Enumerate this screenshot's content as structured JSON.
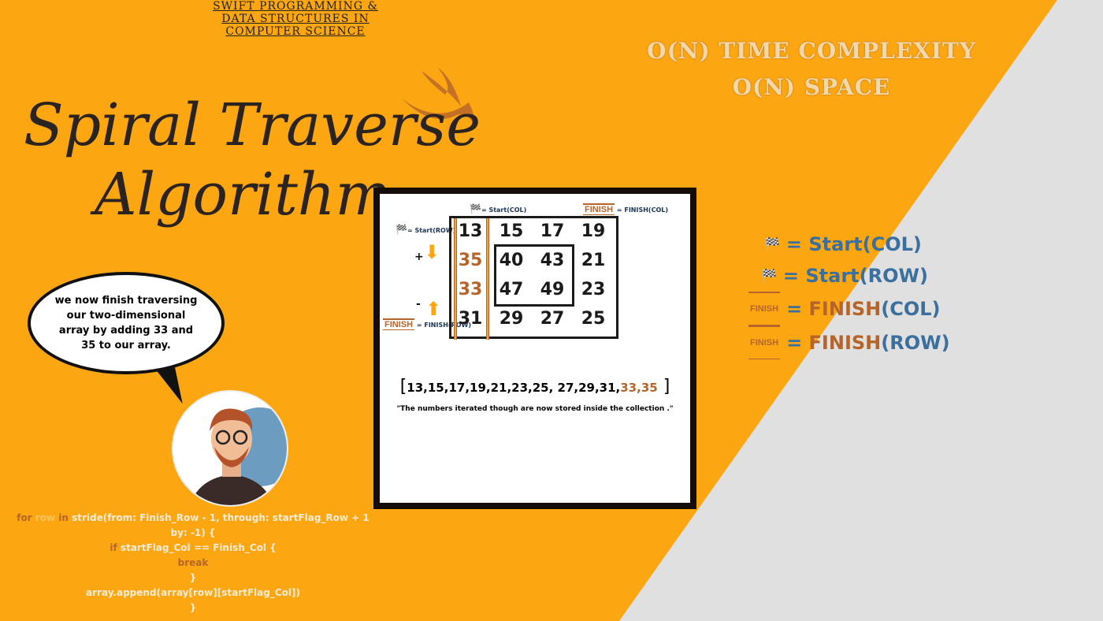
{
  "header": [
    "SWIFT PROGRAMMING &",
    "DATA STRUCTURES IN",
    "COMPUTER SCIENCE"
  ],
  "title": [
    "Spiral Traverse",
    "Algorithm"
  ],
  "complexity": [
    "O(N) TIME COMPLEXITY",
    "O(N) SPACE"
  ],
  "legend": {
    "start_col": "= Start(COL)",
    "start_row": "= Start(ROW)",
    "finish_col_eq": "= ",
    "finish_col_a": "FINISH",
    "finish_col_b": "(COL)",
    "finish_row_eq": "= ",
    "finish_row_a": "FINISH",
    "finish_row_b": "(ROW)",
    "finish_icon": "FINISH"
  },
  "diagram": {
    "start_col": "= Start(COL)",
    "finish_col": "= FINISH(COL)",
    "start_row": "= Start(ROW)",
    "finish_row": "= FINISH(ROW)",
    "finish_icon": "FINISH",
    "plus": "+",
    "minus": "-",
    "matrix": [
      [
        "13",
        "15",
        "17",
        "19"
      ],
      [
        "35",
        "40",
        "43",
        "21"
      ],
      [
        "33",
        "47",
        "49",
        "23"
      ],
      [
        "31",
        "29",
        "27",
        "25"
      ]
    ],
    "result_main": "13,15,17,19,21,23,25, 27,29,31,",
    "result_new": "33,35",
    "note": "\"The numbers iterated though are now stored inside the collection .\""
  },
  "bubble": "we now finish traversing our two-dimensional array by adding 33 and 35 to our array.",
  "code": {
    "l1a": "for",
    "l1b": "row",
    "l1c": "in",
    "l1d": "stride(from: Finish_Row - 1, through: startFlag_Row + 1",
    "l2": "by: -1) {",
    "l3a": "if",
    "l3b": "startFlag_Col == Finish_Col {",
    "l4": "break",
    "l5": "}",
    "l6": "array.append(array[row][startFlag_Col])",
    "l7": "}"
  },
  "colors": {
    "orange": "#FCA711",
    "gray": "#e0e0e0",
    "accent": "#b5642a",
    "blue": "#3a6f9e"
  }
}
